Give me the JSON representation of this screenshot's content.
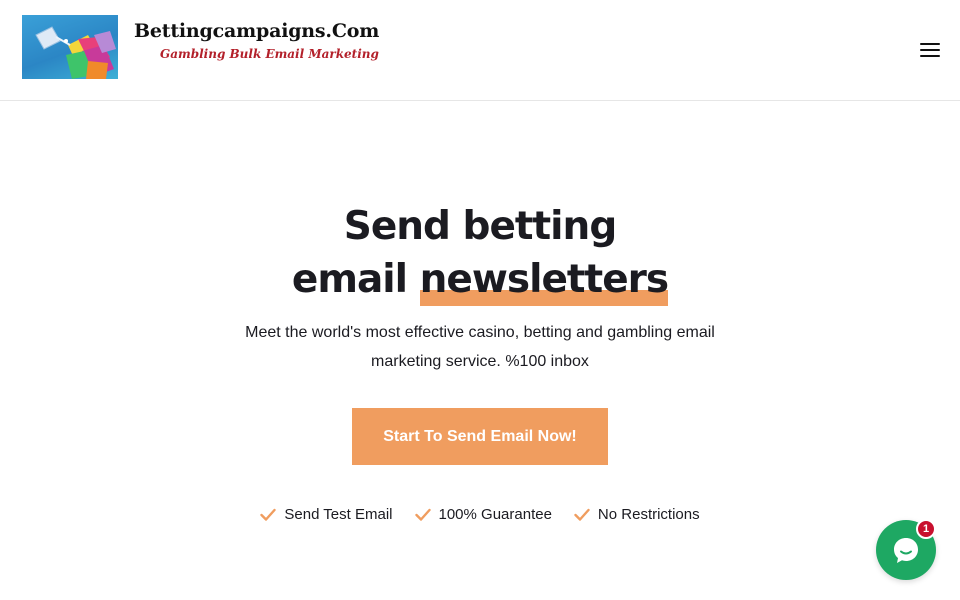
{
  "header": {
    "logo_title": "Bettingcampaigns.Com",
    "logo_tagline": "Gambling Bulk Email Marketing",
    "logo_image_icon": "envelopes-logo-icon",
    "menu_icon": "hamburger-menu-icon"
  },
  "hero": {
    "title_line1": "Send betting",
    "title_line2_plain": "email",
    "title_line2_highlight": "newsletters",
    "subtitle": "Meet the world's most effective casino, betting and gambling email marketing service. %100 inbox",
    "cta_label": "Start To Send Email Now!"
  },
  "features": [
    {
      "label": "Send Test Email",
      "icon": "check-icon"
    },
    {
      "label": "100% Guarantee",
      "icon": "check-icon"
    },
    {
      "label": "No Restrictions",
      "icon": "check-icon"
    }
  ],
  "chat": {
    "icon": "chat-bubble-icon",
    "badge_count": "1"
  },
  "colors": {
    "accent": "#f09d5f",
    "text": "#1b1b21",
    "tagline": "#b3202a",
    "chat_green": "#1ea863",
    "badge_red": "#c8102e"
  }
}
